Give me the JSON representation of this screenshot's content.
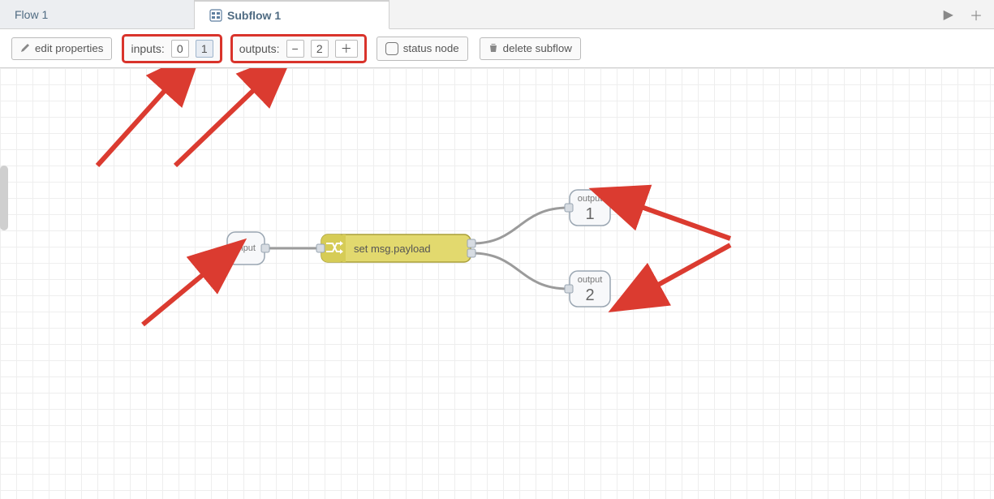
{
  "tabs": {
    "flow": {
      "label": "Flow 1"
    },
    "subflow": {
      "label": "Subflow 1"
    }
  },
  "tab_actions": {
    "run_icon": "▶",
    "add_icon": "＋"
  },
  "toolbar": {
    "edit_properties": "edit properties",
    "inputs_label": "inputs:",
    "inputs_options": {
      "zero": "0",
      "one": "1"
    },
    "inputs_selected": "1",
    "outputs_label": "outputs:",
    "outputs_value": "2",
    "outputs_minus": "−",
    "outputs_plus": "＋",
    "status_node": "status node",
    "delete_subflow": "delete subflow"
  },
  "canvas": {
    "input_node": {
      "label": "input"
    },
    "change_node": {
      "label": "set msg.payload"
    },
    "output1": {
      "small": "output",
      "num": "1"
    },
    "output2": {
      "small": "output",
      "num": "2"
    }
  }
}
